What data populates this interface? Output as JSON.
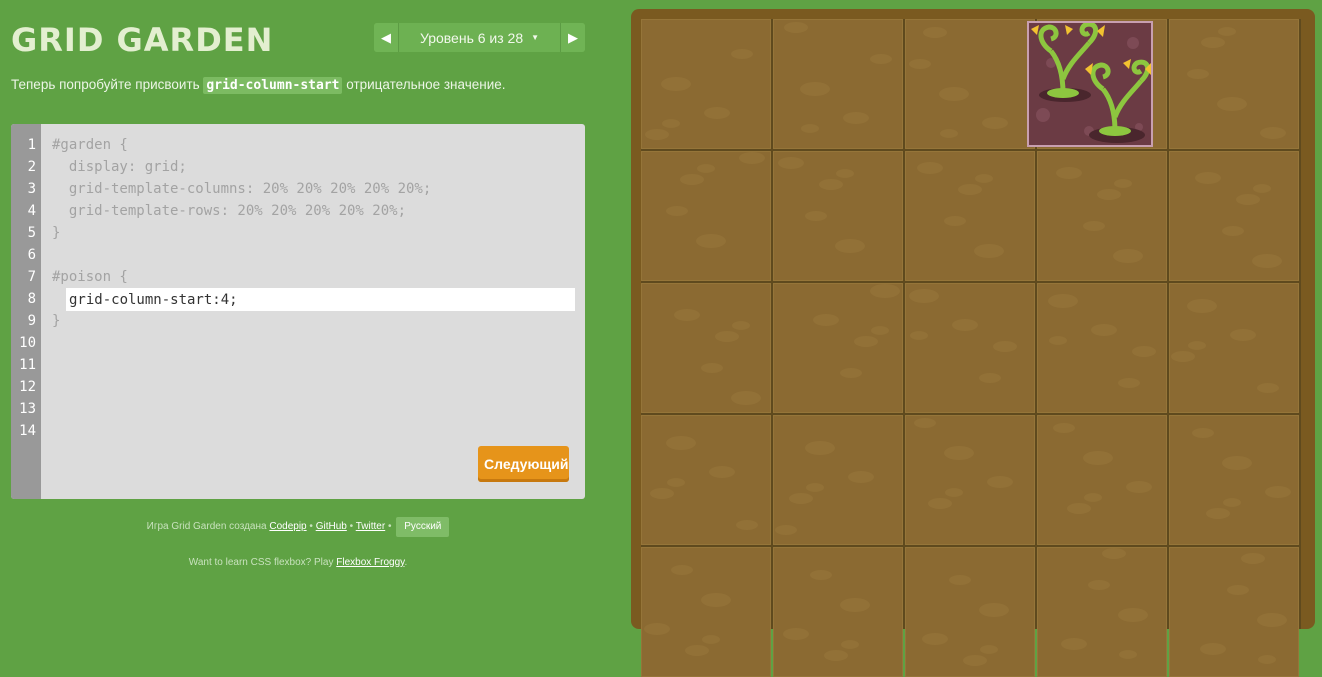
{
  "title": "GRID GARDEN",
  "level_nav": {
    "prev_icon": "triangle-left-icon",
    "next_icon": "triangle-right-icon",
    "level_text": "Уровень 6 из 28",
    "caret": "▼"
  },
  "instructions": {
    "before": "Теперь попробуйте присвоить ",
    "code": "grid-column-start",
    "after": " отрицательное значение."
  },
  "editor": {
    "line_numbers": [
      "1",
      "2",
      "3",
      "4",
      "5",
      "6",
      "7",
      "8",
      "9",
      "10",
      "11",
      "12",
      "13",
      "14"
    ],
    "lines": [
      "#garden {",
      "  display: grid;",
      "  grid-template-columns: 20% 20% 20% 20% 20%;",
      "  grid-template-rows: 20% 20% 20% 20% 20%;",
      "}",
      "",
      "#poison {",
      "",
      "}"
    ],
    "input_value": "grid-column-start:4;",
    "next_label": "Следующий"
  },
  "footer": {
    "credit_prefix": "Игра Grid Garden создана",
    "codepip": "Codepip",
    "github": "GitHub",
    "twitter": "Twitter",
    "separator": "•",
    "language": "Русский",
    "flexbox_prefix": "Want to learn CSS flexbox? Play",
    "flexbox_link": "Flexbox Froggy",
    "flexbox_suffix": "."
  },
  "colors": {
    "background": "#5fa244",
    "soil": "#8b6a32",
    "poison_bg": "#6b3b44",
    "weed": "#8dc63f",
    "next_button": "#e6941a"
  }
}
